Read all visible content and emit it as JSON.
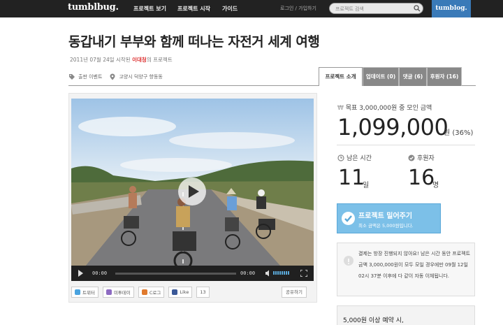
{
  "header": {
    "logo": "tumblbug.",
    "nav": [
      "프로젝트 보기",
      "프로젝트 시작",
      "가이드"
    ],
    "login": "로그인 / 가입하기",
    "search_placeholder": "프로젝트 검색",
    "tumblog": "tumblog."
  },
  "project": {
    "title": "동갑내기 부부와 함께 떠나는 자전거 세계 여행",
    "meta_prefix": "2011년 07월 24일 시작된",
    "author": "이대청",
    "meta_suffix": "의 프로젝트",
    "category": "출판 이벤트",
    "location": "고양시 덕양구 향동동"
  },
  "tabs": [
    {
      "label": "프로젝트 소개",
      "active": true
    },
    {
      "label": "업데이트 (0)",
      "active": false
    },
    {
      "label": "댓글 (6)",
      "active": false
    },
    {
      "label": "후원자 (16)",
      "active": false
    }
  ],
  "video": {
    "time_current": "00:00",
    "time_total": "00:00"
  },
  "shares": [
    {
      "label": "트위터",
      "color": "#4aa3df"
    },
    {
      "label": "미투데이",
      "color": "#8d6bc2"
    },
    {
      "label": "C로그",
      "color": "#e07a2d"
    },
    {
      "label": "Like",
      "color": "#3b5998"
    },
    {
      "label": "13",
      "color": "#ffffff"
    }
  ],
  "share_button": "공유하기",
  "funding": {
    "goal_label": "목표 3,000,000원 중 모인 금액",
    "amount": "1,099,000",
    "amount_unit": "원 (36%)",
    "time_label": "남은 시간",
    "time_value": "11",
    "time_unit": "일",
    "backers_label": "후원자",
    "backers_value": "16",
    "backers_unit": "명"
  },
  "back_button": {
    "label": "프로젝트 밀어주기",
    "sub": "최소 금액은 5,000원입니다."
  },
  "notice": "결제는 방장 진행되지 않아요! 남은 시간 동안 프로젝트 금액 3,000,000원이 모두 모일 경우에만 09월 12일 02시 37분 이후에 다 같이 자동 이체됩니다.",
  "reward": "5,000원 이상 예약 시,",
  "colors": {
    "accent": "#7cc0e8",
    "topbar": "#222222",
    "tumblog": "#3a7ab8",
    "author": "#dd3333"
  }
}
